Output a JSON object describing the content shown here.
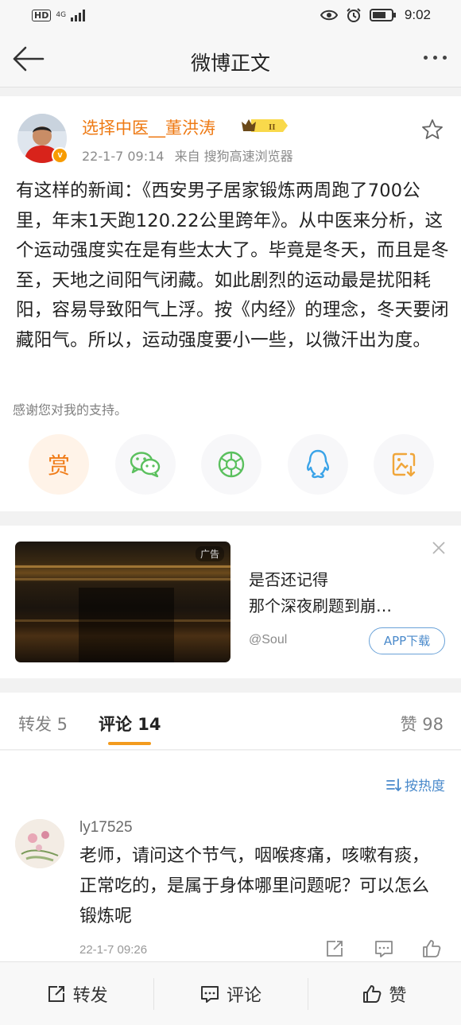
{
  "status_bar": {
    "hd": "HD",
    "network": "4G",
    "time": "9:02",
    "icons": [
      "eye-icon",
      "alarm-icon",
      "battery-icon"
    ]
  },
  "header": {
    "title": "微博正文",
    "back_icon": "back-arrow-icon",
    "more_icon": "more-dots-icon"
  },
  "post": {
    "author": "选择中医__董洪涛",
    "rank_badge": "II",
    "timestamp": "22-1-7 09:14",
    "source": "来自 搜狗高速浏览器",
    "text": "有这样的新闻：《西安男子居家锻炼两周跑了700公里，年末1天跑120.22公里跨年》。从中医来分析，这个运动强度实在是有些太大了。毕竟是冬天，而且是冬至，天地之间阳气闭藏。如此剧烈的运动最是扰阳耗阳，容易导致阳气上浮。按《内经》的理念，冬天要闭藏阳气。所以，运动强度要小一些，以微汗出为度。",
    "thanks": "感谢您对我的支持。",
    "share_buttons": [
      {
        "name": "reward",
        "label": "赏",
        "color": "#f07b17"
      },
      {
        "name": "wechat",
        "icon": "wechat-icon",
        "color": "#5bc05e"
      },
      {
        "name": "moments",
        "icon": "moments-icon",
        "color": "#5bc05e"
      },
      {
        "name": "qq",
        "icon": "qq-icon",
        "color": "#3aa3e8"
      },
      {
        "name": "save-image",
        "icon": "save-image-icon",
        "color": "#f0a63a"
      }
    ]
  },
  "ad": {
    "tag": "广告",
    "title": "是否还记得\n那个深夜刷题到崩…",
    "source": "@Soul",
    "download_label": "APP下载"
  },
  "tabs": {
    "repost": "转发 5",
    "comment": "评论 14",
    "like": "赞 98"
  },
  "comments": {
    "sort_label": "按热度",
    "items": [
      {
        "user": "ly17525",
        "text": "老师，请问这个节气，咽喉疼痛，咳嗽有痰，正常吃的，是属于身体哪里问题呢？可以怎么锻炼呢",
        "time": "22-1-7 09:26"
      }
    ]
  },
  "bottom_bar": {
    "repost": "转发",
    "comment": "评论",
    "like": "赞"
  },
  "colors": {
    "accent": "#f39b1e",
    "author": "#ee7a14",
    "link": "#4a8acb"
  }
}
